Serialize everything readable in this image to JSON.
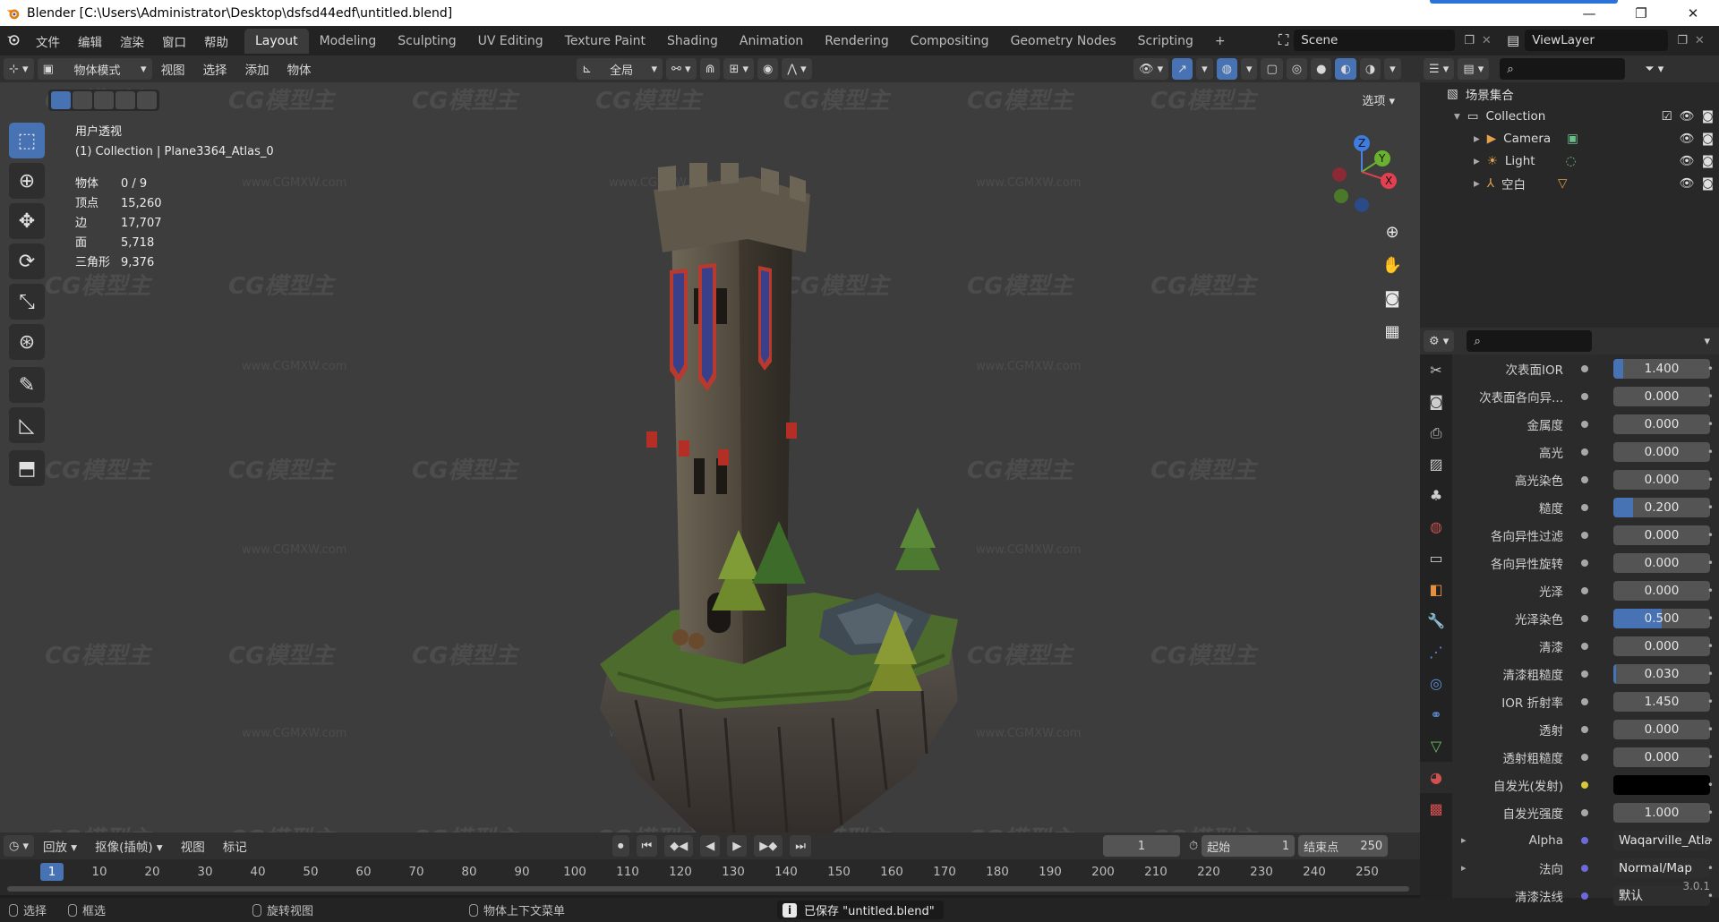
{
  "window": {
    "title": "Blender [C:\\Users\\Administrator\\Desktop\\dsfsd44edf\\untitled.blend]",
    "minimize": "—",
    "maximize": "❐",
    "close": "✕"
  },
  "menu": [
    "文件",
    "编辑",
    "渲染",
    "窗口",
    "帮助"
  ],
  "workspaces": [
    "Layout",
    "Modeling",
    "Sculpting",
    "UV Editing",
    "Texture Paint",
    "Shading",
    "Animation",
    "Rendering",
    "Compositing",
    "Geometry Nodes",
    "Scripting"
  ],
  "add_workspace": "+",
  "scene": {
    "label": "Scene"
  },
  "view_layer": {
    "label": "ViewLayer"
  },
  "viewport_header": {
    "mode": "物体模式",
    "menus": [
      "视图",
      "选择",
      "添加",
      "物体"
    ],
    "orientation": "全局",
    "options": "选项"
  },
  "viewport": {
    "view_name": "用户透视",
    "collection_info": "(1) Collection | Plane3364_Atlas_0",
    "stats": [
      {
        "key": "物体",
        "value": "0 / 9"
      },
      {
        "key": "顶点",
        "value": "15,260"
      },
      {
        "key": "边",
        "value": "17,707"
      },
      {
        "key": "面",
        "value": "5,718"
      },
      {
        "key": "三角形",
        "value": "9,376"
      }
    ],
    "watermark": "CG模型主",
    "watermark_url": "www.CGMXW.com",
    "axis_labels": {
      "z": "Z",
      "y": "Y",
      "x": "X"
    }
  },
  "timeline": {
    "menus": [
      "回放",
      "抠像(插帧)",
      "视图",
      "标记"
    ],
    "current_frame": "1",
    "start_label": "起始",
    "start": "1",
    "end_label": "结束点",
    "end": "250",
    "ticks": [
      "1",
      "10",
      "20",
      "30",
      "40",
      "50",
      "60",
      "70",
      "80",
      "90",
      "100",
      "110",
      "120",
      "130",
      "140",
      "150",
      "160",
      "170",
      "180",
      "190",
      "200",
      "210",
      "220",
      "230",
      "240",
      "250"
    ]
  },
  "statusbar": {
    "select": "选择",
    "box_select": "框选",
    "rotate_view": "旋转视图",
    "context_menu": "物体上下文菜单",
    "saved_message": "已保存 \"untitled.blend\"",
    "version": "3.0.1"
  },
  "outliner": {
    "root": "场景集合",
    "items": [
      {
        "label": "Collection"
      },
      {
        "label": "Camera"
      },
      {
        "label": "Light"
      },
      {
        "label": "空白"
      }
    ]
  },
  "properties": {
    "rows": [
      {
        "label": "次表面IOR",
        "value": "1.400",
        "fill": 0.1
      },
      {
        "label": "次表面各向异...",
        "value": "0.000",
        "fill": 0
      },
      {
        "label": "金属度",
        "value": "0.000",
        "fill": 0
      },
      {
        "label": "高光",
        "value": "0.000",
        "fill": 0
      },
      {
        "label": "高光染色",
        "value": "0.000",
        "fill": 0
      },
      {
        "label": "糙度",
        "value": "0.200",
        "fill": 0.2
      },
      {
        "label": "各向异性过滤",
        "value": "0.000",
        "fill": 0
      },
      {
        "label": "各向异性旋转",
        "value": "0.000",
        "fill": 0
      },
      {
        "label": "光泽",
        "value": "0.000",
        "fill": 0
      },
      {
        "label": "光泽染色",
        "value": "0.500",
        "fill": 0.5
      },
      {
        "label": "清漆",
        "value": "0.000",
        "fill": 0
      },
      {
        "label": "清漆粗糙度",
        "value": "0.030",
        "fill": 0.03
      },
      {
        "label": "IOR 折射率",
        "value": "1.450",
        "fill": 0
      },
      {
        "label": "透射",
        "value": "0.000",
        "fill": 0
      },
      {
        "label": "透射粗糙度",
        "value": "0.000",
        "fill": 0
      },
      {
        "label": "自发光(发射)",
        "value": "",
        "fill": 0
      },
      {
        "label": "自发光强度",
        "value": "1.000",
        "fill": 0
      },
      {
        "label": "Alpha",
        "value": "Waqarville_Atla...",
        "fill": 0
      },
      {
        "label": "法向",
        "value": "Normal/Map",
        "fill": 0
      },
      {
        "label": "清漆法线",
        "value": "默认",
        "fill": 0
      }
    ]
  }
}
